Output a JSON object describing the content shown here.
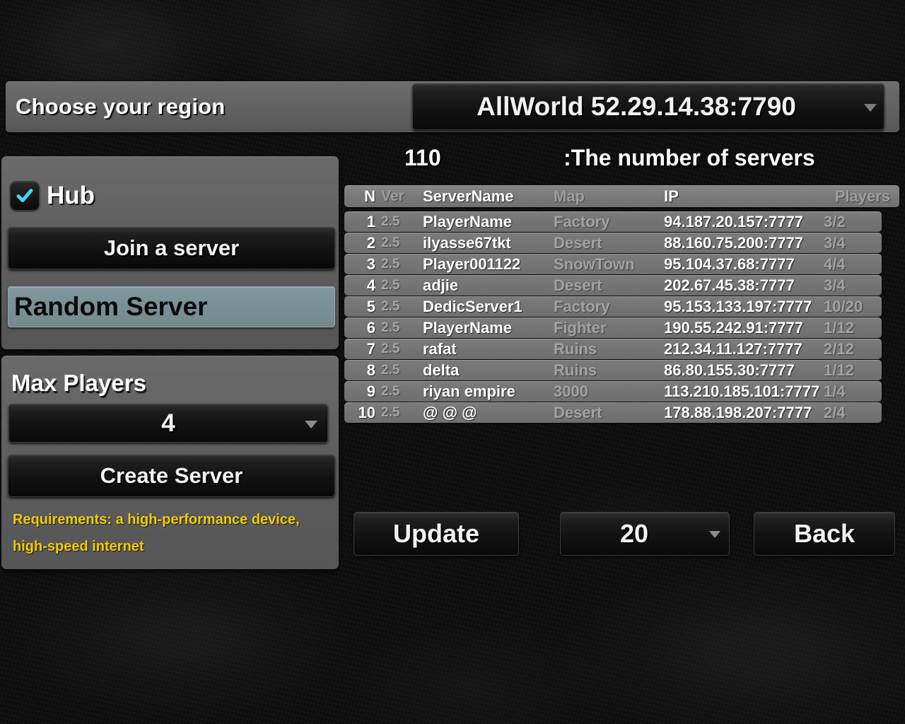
{
  "colors": {
    "accent_cyan": "#3fd8ef",
    "warning_yellow": "#f2cb0c",
    "highlight_slate": "#7b9199",
    "panel_grey": "#5f5f5f",
    "row_grey": "#777777"
  },
  "region_bar": {
    "label": "Choose your region",
    "selected_region": "AllWorld 52.29.14.38:7790",
    "caret_icon": "chevron-down-icon"
  },
  "left_panel": {
    "hub": {
      "label": "Hub",
      "checked": true,
      "check_icon": "checkmark-icon"
    },
    "join_button": "Join a server",
    "random_server_button": "Random Server",
    "max_players": {
      "label": "Max Players",
      "value": "4",
      "caret_icon": "chevron-down-icon"
    },
    "create_button": "Create Server",
    "requirements": "Requirements: a high-performance device, high-speed internet"
  },
  "server_count": {
    "number": "110",
    "caption": ":The number of servers"
  },
  "table": {
    "headers": {
      "n": "N",
      "ver": "Ver",
      "name": "ServerName",
      "map": "Map",
      "ip": "IP",
      "players": "Players"
    },
    "rows": [
      {
        "n": "1",
        "ver": "2.5",
        "name": "PlayerName",
        "map": "Factory",
        "ip": "94.187.20.157:7777",
        "players": "3/2"
      },
      {
        "n": "2",
        "ver": "2.5",
        "name": "ilyasse67tkt",
        "map": "Desert",
        "ip": "88.160.75.200:7777",
        "players": "3/4"
      },
      {
        "n": "3",
        "ver": "2.5",
        "name": "Player001122",
        "map": "SnowTown",
        "ip": "95.104.37.68:7777",
        "players": "4/4"
      },
      {
        "n": "4",
        "ver": "2.5",
        "name": "adjie",
        "map": "Desert",
        "ip": "202.67.45.38:7777",
        "players": "3/4"
      },
      {
        "n": "5",
        "ver": "2.5",
        "name": "DedicServer1",
        "map": "Factory",
        "ip": "95.153.133.197:7777",
        "players": "10/20"
      },
      {
        "n": "6",
        "ver": "2.5",
        "name": "PlayerName",
        "map": "Fighter",
        "ip": "190.55.242.91:7777",
        "players": "1/12"
      },
      {
        "n": "7",
        "ver": "2.5",
        "name": "rafat",
        "map": "Ruins",
        "ip": "212.34.11.127:7777",
        "players": "2/12"
      },
      {
        "n": "8",
        "ver": "2.5",
        "name": "delta",
        "map": "Ruins",
        "ip": "86.80.155.30:7777",
        "players": "1/12"
      },
      {
        "n": "9",
        "ver": "2.5",
        "name": "riyan empire",
        "map": "3000",
        "ip": "113.210.185.101:7777",
        "players": "1/4"
      },
      {
        "n": "10",
        "ver": "2.5",
        "name": "@ @ @",
        "map": "Desert",
        "ip": "178.88.198.207:7777",
        "players": "2/4"
      }
    ]
  },
  "footer": {
    "update_button": "Update",
    "page_size": "20",
    "page_size_caret_icon": "chevron-down-icon",
    "back_button": "Back"
  }
}
